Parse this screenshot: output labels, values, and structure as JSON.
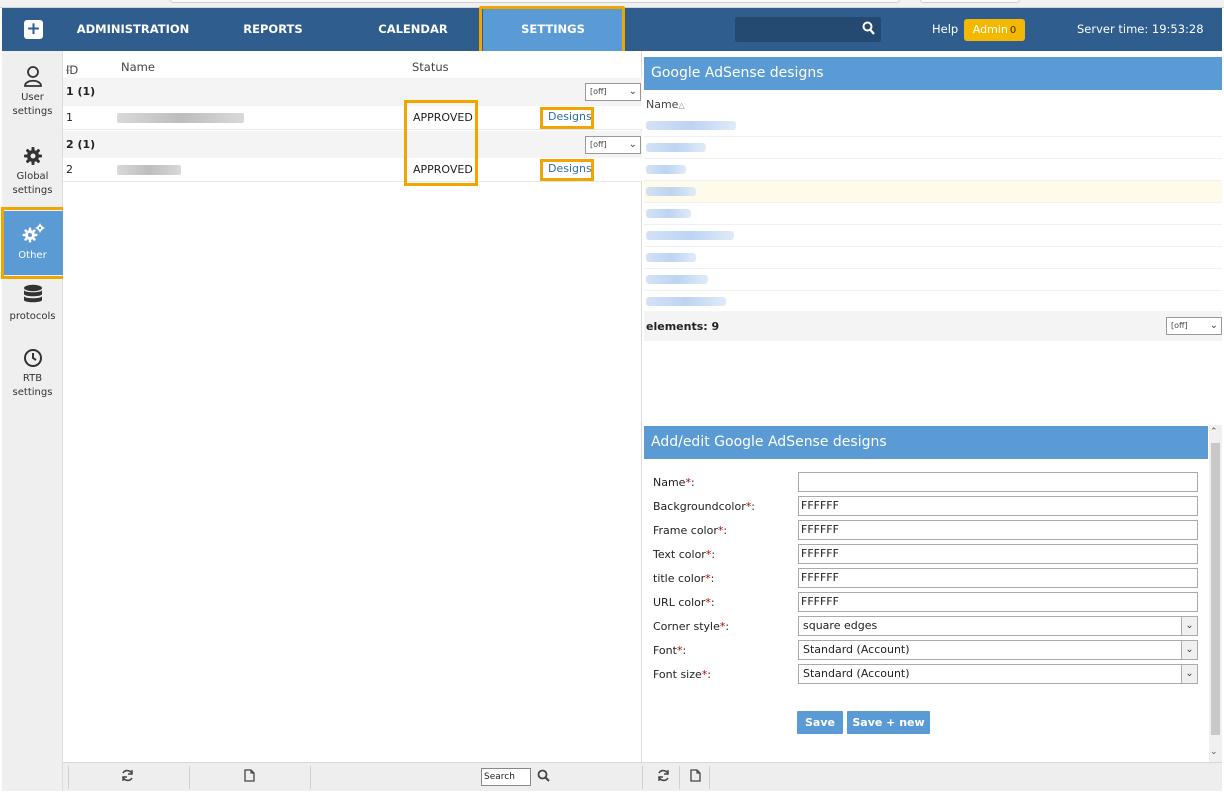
{
  "topbar": {
    "nav": [
      {
        "label": "ADMINISTRATION"
      },
      {
        "label": "REPORTS"
      },
      {
        "label": "CALENDAR"
      },
      {
        "label": "SETTINGS",
        "active": true
      }
    ],
    "help_label": "Help",
    "admin_label": "Admin",
    "admin_count": "0",
    "server_time_label": "Server time: 19:53:28"
  },
  "sidebar": {
    "items": [
      {
        "label_line1": "User",
        "label_line2": "settings",
        "icon": "user-icon"
      },
      {
        "label_line1": "Global",
        "label_line2": "settings",
        "icon": "gear-icon"
      },
      {
        "label_line1": "Other",
        "label_line2": "",
        "icon": "gears-icon",
        "active": true
      },
      {
        "label_line1": "protocols",
        "label_line2": "",
        "icon": "database-icon"
      },
      {
        "label_line1": "RTB",
        "label_line2": "settings",
        "icon": "clock-icon"
      }
    ]
  },
  "left_table": {
    "columns": {
      "id": "ID",
      "name": "Name",
      "status": "Status"
    },
    "groups": [
      {
        "label": "1 (1)",
        "filter": "[off]"
      },
      {
        "label": "2 (1)",
        "filter": "[off]"
      }
    ],
    "rows": [
      {
        "id": "1",
        "status": "APPROVED",
        "action": "Designs"
      },
      {
        "id": "2",
        "status": "APPROVED",
        "action": "Designs"
      }
    ]
  },
  "left_bottom": {
    "search_value": "Search"
  },
  "adsense_list": {
    "title": "Google AdSense designs",
    "column_name": "Name",
    "elements_label": "elements: 9",
    "filter": "[off]"
  },
  "adsense_form": {
    "title": "Add/edit Google AdSense designs",
    "fields": [
      {
        "label": "Name",
        "value": ""
      },
      {
        "label": "Backgroundcolor",
        "value": "FFFFFF"
      },
      {
        "label": "Frame color",
        "value": "FFFFFF"
      },
      {
        "label": "Text color",
        "value": "FFFFFF"
      },
      {
        "label": "title color",
        "value": "FFFFFF"
      },
      {
        "label": "URL color",
        "value": "FFFFFF"
      },
      {
        "label": "Corner style",
        "value": "square edges"
      },
      {
        "label": "Font",
        "value": "Standard (Account)"
      },
      {
        "label": "Font size",
        "value": "Standard (Account)"
      }
    ],
    "required_mark": "*",
    "label_suffix": ":",
    "save_label": "Save",
    "save_new_label": "Save + new"
  },
  "colors": {
    "topbar": "#2e5d8e",
    "accent": "#5b9bd5",
    "highlight": "#f0a500",
    "admin_badge": "#f5b800"
  }
}
